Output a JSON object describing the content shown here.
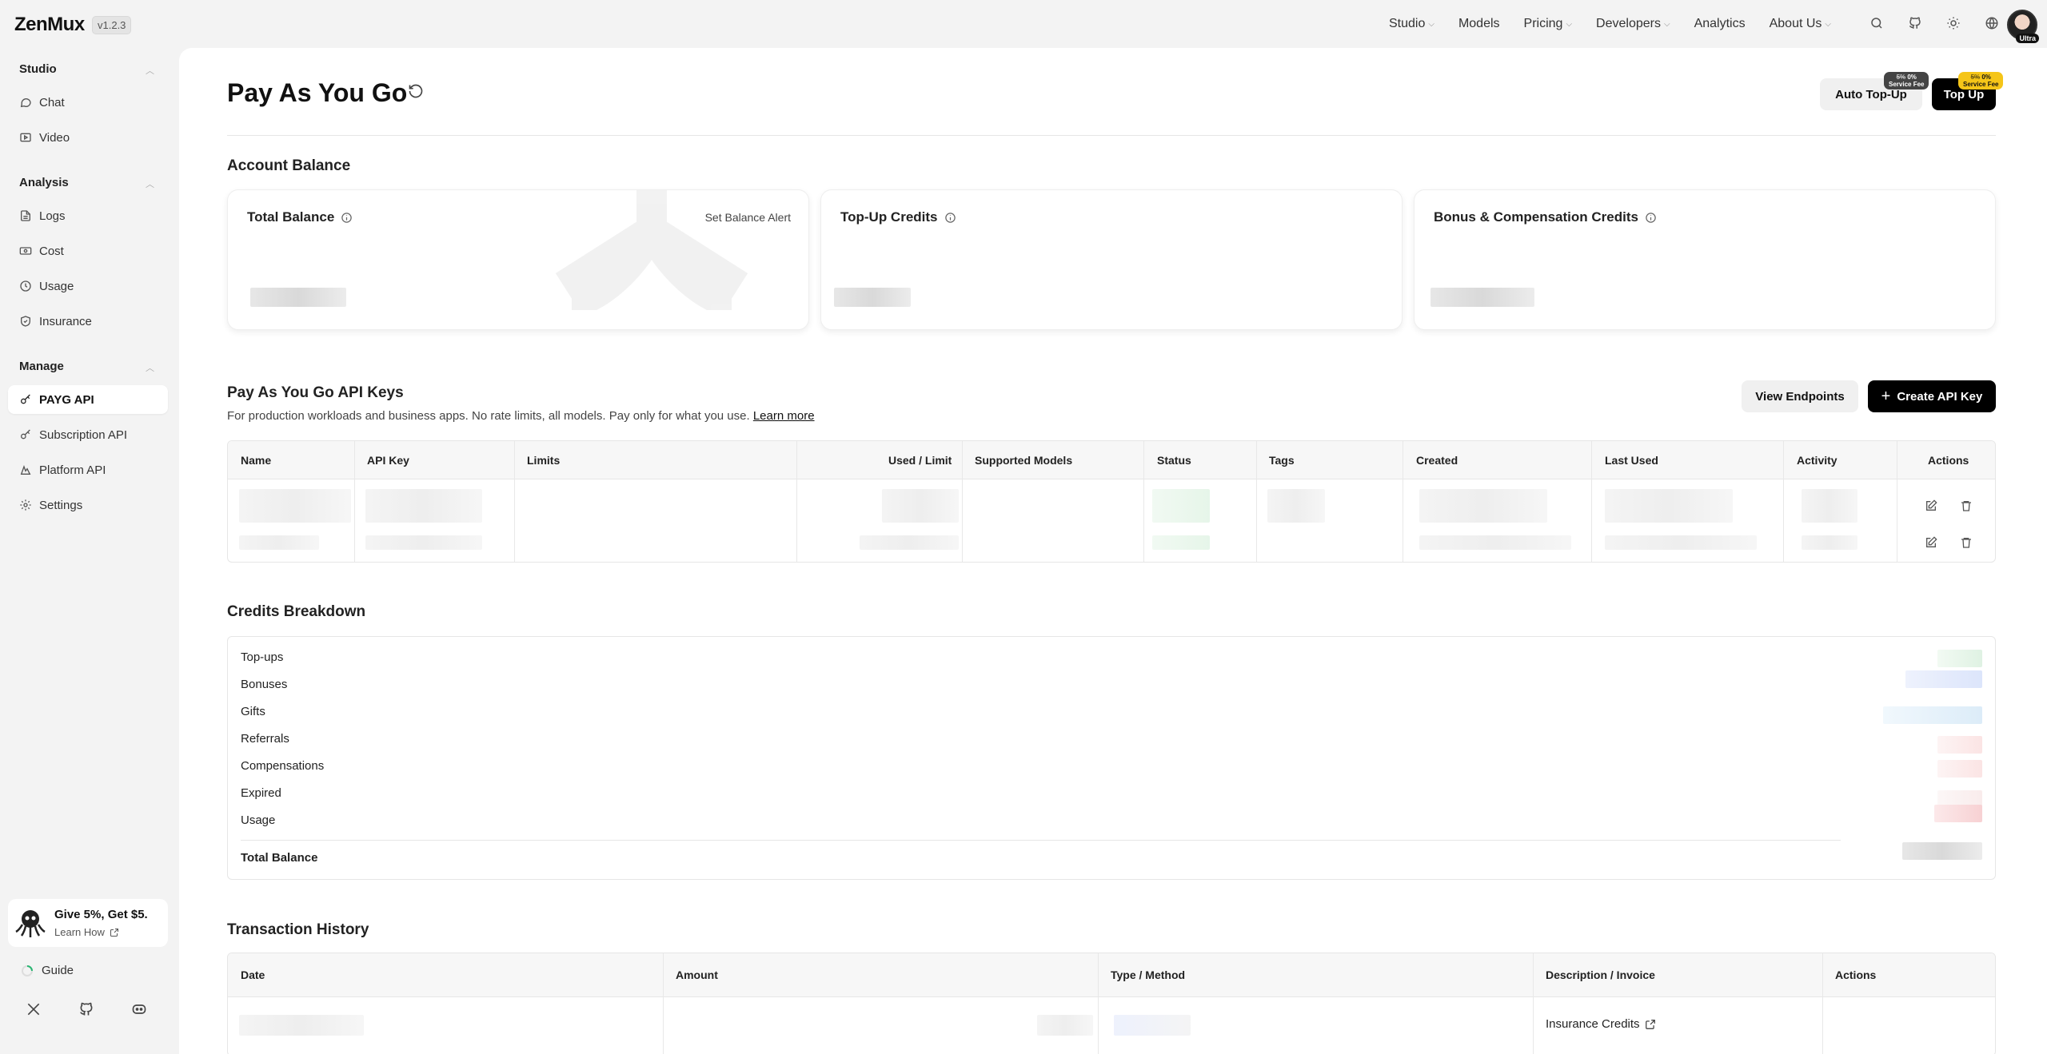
{
  "app": {
    "logo": "ZenMux",
    "version": "v1.2.3"
  },
  "nav": [
    {
      "label": "Studio",
      "dropdown": true
    },
    {
      "label": "Models",
      "dropdown": false
    },
    {
      "label": "Pricing",
      "dropdown": true
    },
    {
      "label": "Developers",
      "dropdown": true
    },
    {
      "label": "Analytics",
      "dropdown": false
    },
    {
      "label": "About Us",
      "dropdown": true
    }
  ],
  "tools": [
    "search-icon",
    "github-icon",
    "sun-icon",
    "globe-icon"
  ],
  "avatar": {
    "badge": "Ultra"
  },
  "sidebar": {
    "sections": [
      {
        "title": "Studio",
        "items": [
          {
            "label": "Chat",
            "icon": "chat-icon"
          },
          {
            "label": "Video",
            "icon": "video-icon"
          }
        ]
      },
      {
        "title": "Analysis",
        "items": [
          {
            "label": "Logs",
            "icon": "logs-icon"
          },
          {
            "label": "Cost",
            "icon": "cost-icon"
          },
          {
            "label": "Usage",
            "icon": "usage-icon"
          },
          {
            "label": "Insurance",
            "icon": "shield-icon"
          }
        ]
      },
      {
        "title": "Manage",
        "items": [
          {
            "label": "PAYG API",
            "icon": "key-icon",
            "active": true
          },
          {
            "label": "Subscription API",
            "icon": "key-icon"
          },
          {
            "label": "Platform API",
            "icon": "platform-icon"
          },
          {
            "label": "Settings",
            "icon": "gear-icon"
          }
        ]
      }
    ],
    "promo": {
      "title": "Give 5%, Get $5.",
      "link": "Learn How"
    },
    "guide": "Guide"
  },
  "page": {
    "title": "Pay As You Go",
    "auto_topup": "Auto Top-Up",
    "topup": "Top Up",
    "fee_badge_percent": "0%",
    "fee_badge_text": "Service Fee",
    "fee_badge_struck": "5%"
  },
  "account_balance": {
    "heading": "Account Balance",
    "cards": [
      {
        "title": "Total Balance",
        "action": "Set Balance Alert"
      },
      {
        "title": "Top-Up Credits"
      },
      {
        "title": "Bonus & Compensation Credits"
      }
    ]
  },
  "api_keys": {
    "heading": "Pay As You Go API Keys",
    "description": "For production workloads and business apps. No rate limits, all models. Pay only for what you use.",
    "learn_more": "Learn more",
    "view_endpoints": "View Endpoints",
    "create": "Create API Key",
    "columns": [
      "Name",
      "API Key",
      "Limits",
      "Used / Limit",
      "Supported Models",
      "Status",
      "Tags",
      "Created",
      "Last Used",
      "Activity",
      "Actions"
    ]
  },
  "credits_breakdown": {
    "heading": "Credits Breakdown",
    "rows": [
      "Top-ups",
      "Bonuses",
      "Gifts",
      "Referrals",
      "Compensations",
      "Expired",
      "Usage"
    ],
    "total_label": "Total Balance"
  },
  "transactions": {
    "heading": "Transaction History",
    "columns": [
      "Date",
      "Amount",
      "Type / Method",
      "Description / Invoice",
      "Actions"
    ],
    "first_row_description": "Insurance Credits"
  }
}
